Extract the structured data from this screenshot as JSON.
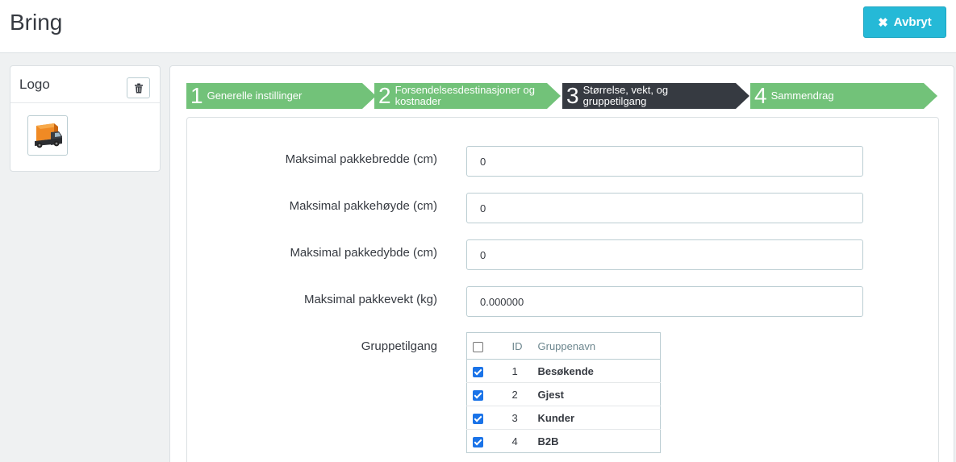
{
  "header": {
    "title": "Bring",
    "cancel_label": "Avbryt",
    "cancel_icon": "close-icon"
  },
  "logo_panel": {
    "title": "Logo",
    "delete_icon": "trash-icon",
    "image": "truck-logo"
  },
  "steps": [
    {
      "num": "1",
      "label": "Generelle instillinger",
      "state": "done"
    },
    {
      "num": "2",
      "label": "Forsendelsesdestinasjoner og kostnader",
      "state": "done"
    },
    {
      "num": "3",
      "label": "Størrelse, vekt, og gruppetilgang",
      "state": "active"
    },
    {
      "num": "4",
      "label": "Sammendrag",
      "state": "todo"
    }
  ],
  "form": {
    "width": {
      "label": "Maksimal pakkebredde (cm)",
      "value": "0"
    },
    "height": {
      "label": "Maksimal pakkehøyde (cm)",
      "value": "0"
    },
    "depth": {
      "label": "Maksimal pakkedybde (cm)",
      "value": "0"
    },
    "weight": {
      "label": "Maksimal pakkevekt (kg)",
      "value": "0.000000"
    },
    "groups": {
      "label": "Gruppetilgang",
      "columns": {
        "id": "ID",
        "name": "Gruppenavn"
      },
      "rows": [
        {
          "id": "1",
          "name": "Besøkende",
          "checked": true
        },
        {
          "id": "2",
          "name": "Gjest",
          "checked": true
        },
        {
          "id": "3",
          "name": "Kunder",
          "checked": true
        },
        {
          "id": "4",
          "name": "B2B",
          "checked": true
        }
      ]
    }
  },
  "colors": {
    "accent": "#25b9d7",
    "step_done": "#72c279",
    "step_active": "#363a41"
  }
}
